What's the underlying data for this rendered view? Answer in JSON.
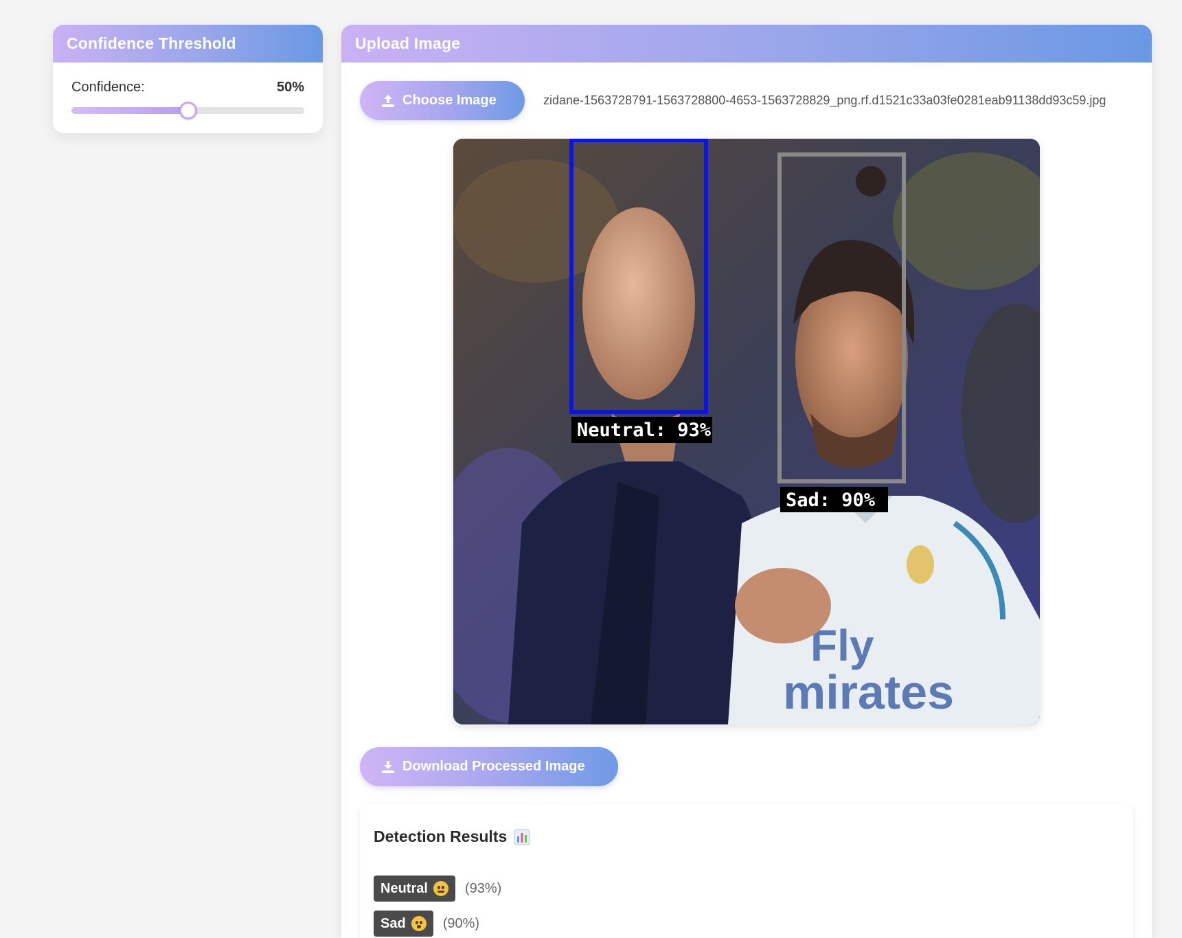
{
  "confidence_panel": {
    "title": "Confidence Threshold",
    "label": "Confidence:",
    "value_text": "50%",
    "value": 0.5,
    "min": 0,
    "max": 1
  },
  "upload_panel": {
    "title": "Upload Image",
    "choose_button": "Choose Image",
    "file_name": "zidane-1563728791-1563728800-4653-1563728829_png.rf.d1521c33a03fe0281eab91138dd93c59.jpg",
    "download_button": "Download Processed Image",
    "detections": [
      {
        "label": "Neutral: 93%",
        "box_color": "#0a14e6"
      },
      {
        "label": "Sad: 90%",
        "box_color": "#8a8a8a"
      }
    ]
  },
  "results": {
    "title": "Detection Results",
    "title_icon": "bar-chart-icon",
    "items": [
      {
        "emotion": "Neutral",
        "emoji": "neutral-face-emoji",
        "percent": "(93%)"
      },
      {
        "emotion": "Sad",
        "emoji": "sad-face-emoji",
        "percent": "(90%)"
      }
    ]
  },
  "colors": {
    "header_gradient_start": "#c9b1f4",
    "header_gradient_end": "#6a98e4",
    "badge_bg": "#4a4a4a",
    "page_bg": "#f4f4f4"
  }
}
